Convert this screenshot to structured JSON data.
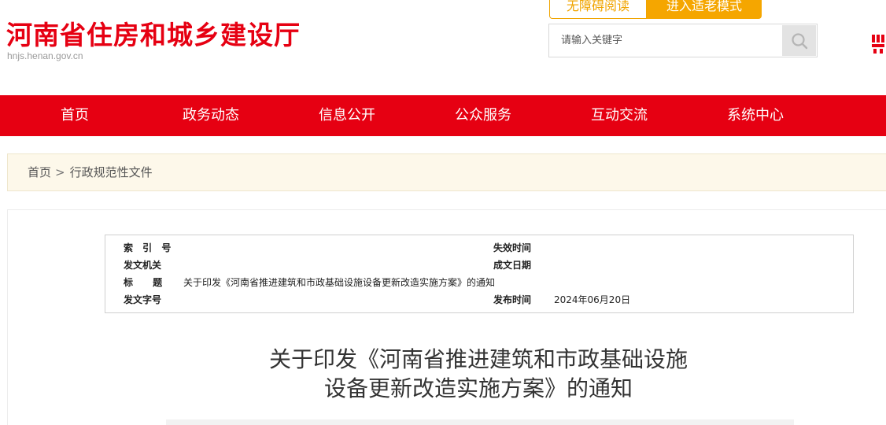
{
  "header": {
    "site_title": "河南省住房和城乡建设厅",
    "site_domain": "hnjs.henan.gov.cn",
    "accessibility_label": "无障碍阅读",
    "elder_mode_label": "进入适老模式",
    "search": {
      "placeholder": "请输入关键字",
      "value": ""
    },
    "icons": {
      "search": "search-icon",
      "edge_logo": "party-emblem-icon"
    },
    "colors": {
      "brand_red": "#e60012",
      "accent_orange": "#f5a600"
    }
  },
  "nav": {
    "items": [
      {
        "label": "首页"
      },
      {
        "label": "政务动态"
      },
      {
        "label": "信息公开"
      },
      {
        "label": "公众服务"
      },
      {
        "label": "互动交流"
      },
      {
        "label": "系统中心"
      }
    ]
  },
  "breadcrumb": {
    "home": "首页",
    "separator": ">",
    "current": "行政规范性文件"
  },
  "meta": {
    "index_label": "索  引  号",
    "index_value": "",
    "expire_label": "失效时间",
    "expire_value": "",
    "issuer_label": "发文机关",
    "issuer_value": "",
    "written_label": "成文日期",
    "written_value": "",
    "title_label": "标      题",
    "title_value": "关于印发《河南省推进建筑和市政基础设施设备更新改造实施方案》的通知",
    "doc_no_label": "发文字号",
    "doc_no_value": "",
    "publish_label": "发布时间",
    "publish_value": "2024年06月20日"
  },
  "document": {
    "title_line1": "关于印发《河南省推进建筑和市政基础设施",
    "title_line2": "设备更新改造实施方案》的通知"
  }
}
